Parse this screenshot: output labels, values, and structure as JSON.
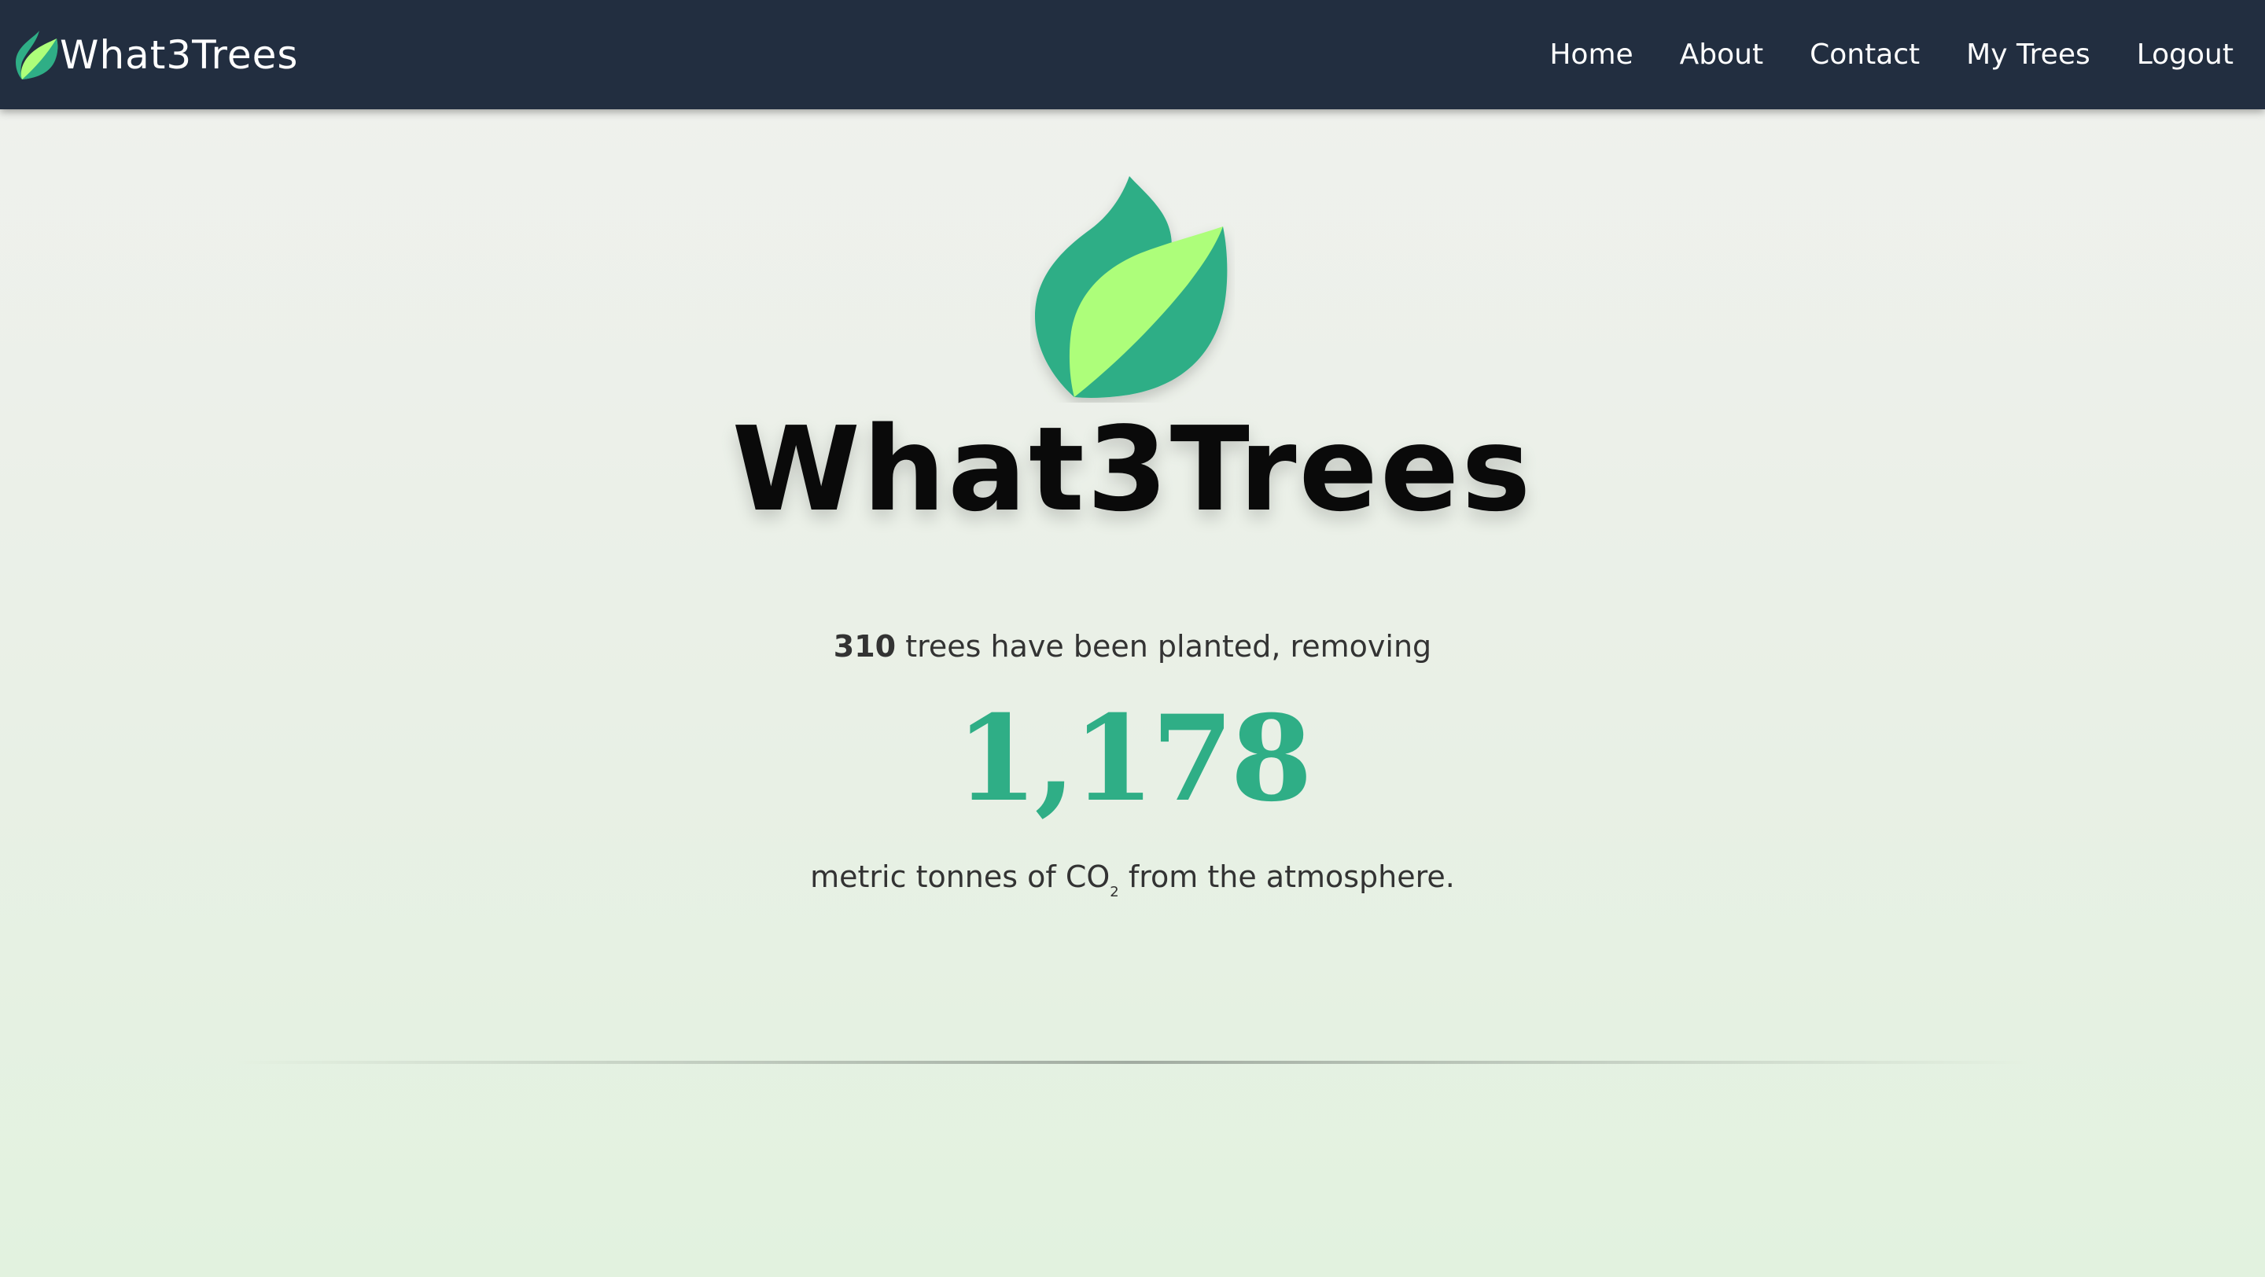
{
  "app": {
    "brand_name": "What3Trees",
    "brand_logo_icon": "leaf-logo-icon"
  },
  "nav": {
    "items": [
      {
        "label": "Home"
      },
      {
        "label": "About"
      },
      {
        "label": "Contact"
      },
      {
        "label": "My Trees"
      },
      {
        "label": "Logout"
      }
    ]
  },
  "hero": {
    "logo_icon": "leaf-logo-icon",
    "title": "What3Trees"
  },
  "stats": {
    "trees_planted": "310",
    "trees_text": " trees have been planted, removing",
    "co2_removed": "1,178",
    "units_prefix": "metric tonnes of CO",
    "units_subscript": "2",
    "units_suffix": " from the atmosphere."
  },
  "colors": {
    "navbar_bg": "#222e40",
    "accent_green": "#2fae86",
    "leaf_light": "#adfe7a",
    "leaf_dark": "#2fae86"
  }
}
